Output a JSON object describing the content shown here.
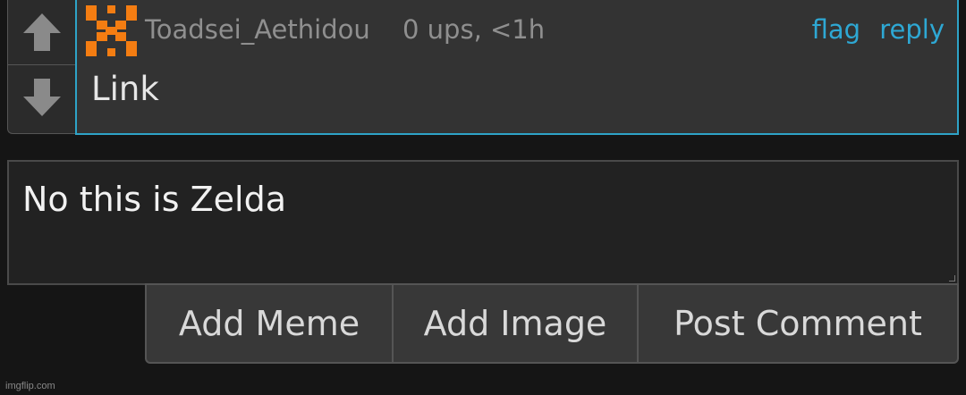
{
  "comment": {
    "username": "Toadsei_Aethidou",
    "meta": "0 ups, <1h",
    "flag_label": "flag",
    "reply_label": "reply",
    "text": "Link",
    "upvote_icon": "arrow-up-icon",
    "downvote_icon": "arrow-down-icon",
    "avatar_colors": [
      "#f47d12",
      "#333333"
    ]
  },
  "reply": {
    "value": "No this is Zelda"
  },
  "buttons": {
    "add_meme": "Add Meme",
    "add_image": "Add Image",
    "post_comment": "Post Comment"
  },
  "watermark": "imgflip.com",
  "colors": {
    "accent": "#2ea8d4",
    "background": "#151515"
  }
}
